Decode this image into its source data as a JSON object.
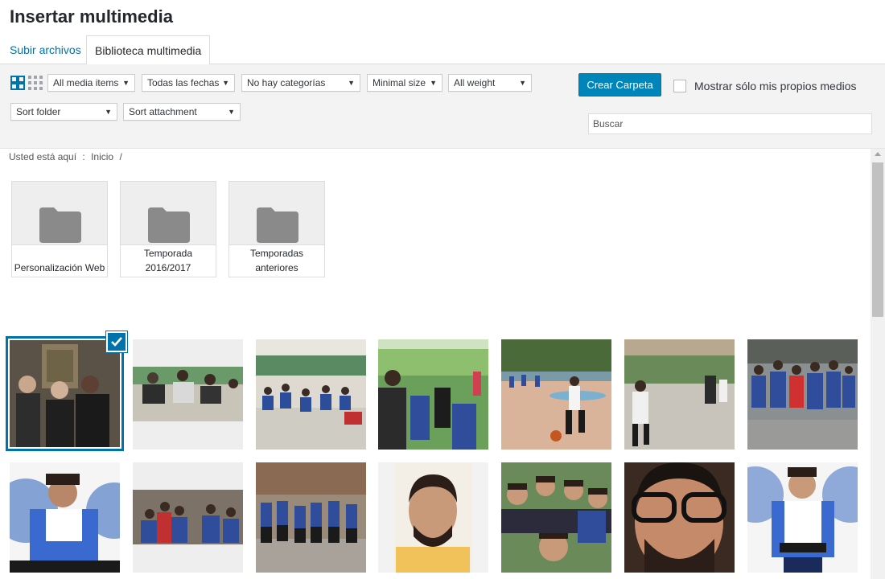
{
  "title": "Insertar multimedia",
  "tabs": [
    {
      "label": "Subir archivos",
      "active": false
    },
    {
      "label": "Biblioteca multimedia",
      "active": true
    }
  ],
  "filters": {
    "media_type": "All media items",
    "dates": "Todas las fechas",
    "categories": "No hay categorías",
    "size": "Minimal size",
    "weight": "All weight",
    "sort_folder": "Sort folder",
    "sort_attachment": "Sort attachment"
  },
  "create_folder_label": "Crear Carpeta",
  "own_media_label": "Mostrar sólo mis propios medios",
  "search_placeholder": "Buscar",
  "breadcrumb": {
    "prefix": "Usted está aquí",
    "separator": ":",
    "home": "Inicio",
    "trail": "/"
  },
  "folders": [
    {
      "name": "Personalización Web"
    },
    {
      "name": "Temporada 2016/2017"
    },
    {
      "name": "Temporadas anteriores"
    }
  ],
  "media_row1": [
    {
      "label": "Foto selfie grupo",
      "selected": true
    },
    {
      "label": "Foto jugadores sentados"
    },
    {
      "label": "Foto pabellón"
    },
    {
      "label": "Foto grupo árboles"
    },
    {
      "label": "Foto partido pista"
    },
    {
      "label": "Foto jugador bote"
    },
    {
      "label": "Foto equipo pista"
    }
  ],
  "media_row2": [
    {
      "label": "Foto jugador Pablo"
    },
    {
      "label": "Foto equipo posando"
    },
    {
      "label": "Foto equipo calle"
    },
    {
      "label": "Foto retrato sonrisa"
    },
    {
      "label": "Foto grupo celebración"
    },
    {
      "label": "Foto retrato gafas"
    },
    {
      "label": "Foto jugador camiseta"
    }
  ],
  "colors": {
    "accent": "#0073aa",
    "button": "#0085ba",
    "folder_icon": "#8a8a8a"
  }
}
